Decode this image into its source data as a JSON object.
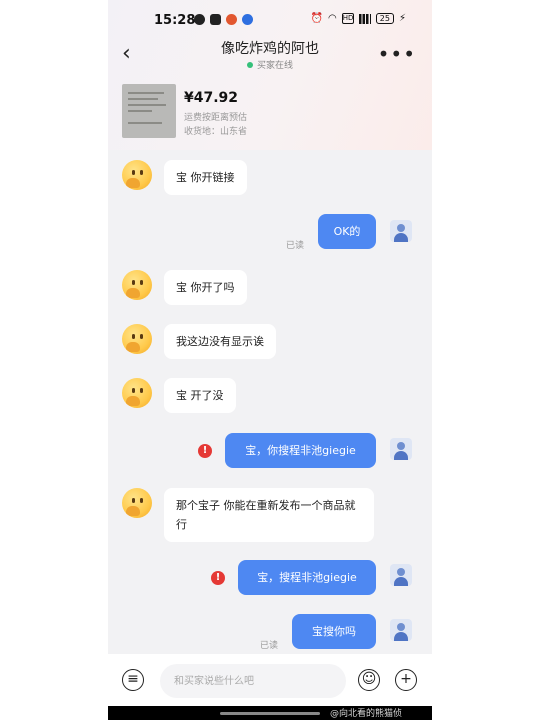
{
  "status_bar": {
    "time": "15:28",
    "battery": "25"
  },
  "header": {
    "contact_name": "像吃炸鸡的阿也",
    "online_status": "买家在线"
  },
  "product": {
    "price": "¥47.92",
    "shipping": "运费按距离预估",
    "ship_from": "收货地：山东省"
  },
  "messages": [
    {
      "from": "buyer",
      "text": "宝 你开链接"
    },
    {
      "from": "me",
      "text": "OK的",
      "read": "已读"
    },
    {
      "from": "buyer",
      "text": "宝 你开了吗"
    },
    {
      "from": "buyer",
      "text": "我这边没有显示诶"
    },
    {
      "from": "buyer",
      "text": "宝 开了没"
    },
    {
      "from": "me",
      "text": "宝，你搜程非池giegie",
      "failed": true
    },
    {
      "from": "buyer",
      "text": "那个宝子 你能在重新发布一个商品就行"
    },
    {
      "from": "me",
      "text": "宝，搜程非池giegie",
      "failed": true
    },
    {
      "from": "me",
      "text": "宝搜你吗",
      "read": "已读"
    }
  ],
  "input": {
    "placeholder": "和买家说些什么吧"
  },
  "icons": {
    "back": "chevron-left-icon",
    "more": "more-dots-icon",
    "menu": "menu-circle-icon",
    "emoji": "smile-icon",
    "add": "plus-circle-icon",
    "error": "error-icon"
  },
  "colors": {
    "bubble_out": "#4e88f2",
    "bubble_in": "#ffffff",
    "error": "#e53935",
    "online": "#35c07a"
  },
  "watermark": "@向北看的熊猫侦"
}
